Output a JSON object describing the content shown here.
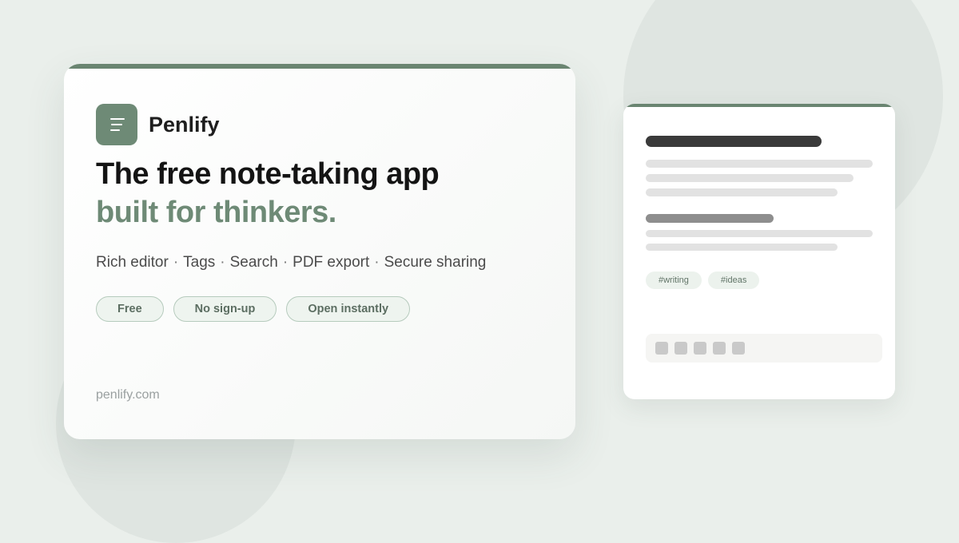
{
  "brand": {
    "name": "Penlify",
    "logo_icon": "notes-lines-icon",
    "accent_color": "#6e8a76",
    "top_bar_color": "#6a8571"
  },
  "headline": {
    "line1": "The free note-taking app",
    "line2": "built for thinkers."
  },
  "features": [
    "Rich editor",
    "Tags",
    "Search",
    "PDF export",
    "Secure sharing"
  ],
  "feature_separator": "·",
  "pills": [
    "Free",
    "No sign-up",
    "Open instantly"
  ],
  "domain": "penlify.com",
  "preview": {
    "tags": [
      "#writing",
      "#ideas"
    ],
    "toolbar_icons": [
      "tool-icon",
      "tool-icon",
      "tool-icon",
      "tool-icon",
      "tool-icon"
    ]
  }
}
